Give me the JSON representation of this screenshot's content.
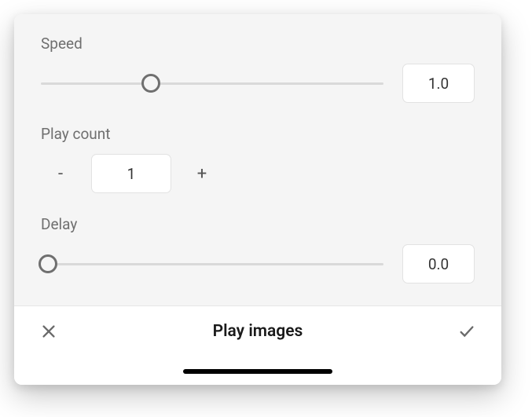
{
  "controls": {
    "speed": {
      "label": "Speed",
      "value": "1.0",
      "thumb_percent": 32
    },
    "play_count": {
      "label": "Play count",
      "value": "1",
      "minus": "-",
      "plus": "+"
    },
    "delay": {
      "label": "Delay",
      "value": "0.0",
      "thumb_percent": 2
    }
  },
  "footer": {
    "title": "Play images"
  }
}
